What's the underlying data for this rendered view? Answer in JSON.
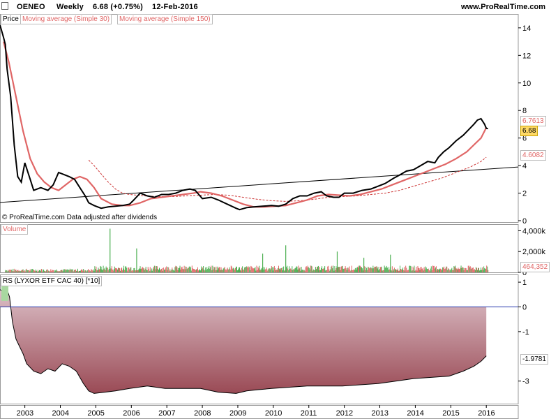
{
  "header": {
    "symbol": "OENEO",
    "period": "Weekly",
    "price_change": "6.68 (+0.75%)",
    "date": "12-Feb-2016",
    "website": "www.ProRealTime.com"
  },
  "price_panel": {
    "legend_price": "Price",
    "legend_ma30": "Moving average (Simple 30)",
    "legend_ma150": "Moving average (Simple 150)",
    "note": "© ProRealTime.com  Data adjusted after dividends",
    "ma30_value": "6.7613",
    "last_price": "6.68",
    "ma150_value": "4.6082"
  },
  "volume_panel": {
    "legend": "Volume",
    "last_value": "464,352"
  },
  "rs_panel": {
    "legend": "RS (LYXOR ETF CAC 40) [*10]",
    "last_value": "-1.9781"
  },
  "colors": {
    "price_line": "#000000",
    "ma30": "#e06666",
    "ma150": "#cc3333",
    "volume_up": "#4caf50",
    "volume_down": "#e06666",
    "rs_zero_line": "#2233aa",
    "rs_fill_top": "#dcc0c8",
    "rs_fill_bottom": "#9a4a55"
  },
  "chart_data": [
    {
      "type": "line",
      "panel": "price",
      "x_ticks": [
        "2003",
        "2004",
        "2005",
        "2006",
        "2007",
        "2008",
        "2009",
        "2010",
        "2011",
        "2012",
        "2013",
        "2014",
        "2015",
        "2016"
      ],
      "y_ticks": [
        0,
        2,
        4,
        6,
        8,
        10,
        12,
        14
      ],
      "ylim": [
        0,
        14.5
      ],
      "series": [
        {
          "name": "Price",
          "x": [
            2002.35,
            2002.45,
            2002.5,
            2002.55,
            2002.65,
            2002.75,
            2002.85,
            2002.95,
            2003.05,
            2003.2,
            2003.3,
            2003.5,
            2003.7,
            2003.85,
            2004.0,
            2004.1,
            2004.3,
            2004.45,
            2004.6,
            2004.75,
            2004.85,
            2005.0,
            2005.2,
            2005.4,
            2005.6,
            2005.8,
            2006.0,
            2006.1,
            2006.3,
            2006.5,
            2006.7,
            2006.9,
            2007.1,
            2007.3,
            2007.5,
            2007.7,
            2007.85,
            2007.95,
            2008.05,
            2008.3,
            2008.5,
            2008.75,
            2009.0,
            2009.1,
            2009.3,
            2009.5,
            2009.75,
            2010.0,
            2010.2,
            2010.4,
            2010.6,
            2010.8,
            2011.0,
            2011.2,
            2011.4,
            2011.55,
            2011.75,
            2011.9,
            2012.05,
            2012.3,
            2012.55,
            2012.8,
            2013.0,
            2013.2,
            2013.45,
            2013.6,
            2013.8,
            2014.0,
            2014.2,
            2014.4,
            2014.6,
            2014.7,
            2014.85,
            2015.0,
            2015.2,
            2015.4,
            2015.55,
            2015.7,
            2015.8,
            2015.9,
            2016.0,
            2016.05,
            2016.1
          ],
          "values": [
            14.2,
            13.3,
            12.8,
            11.0,
            9.0,
            5.5,
            3.2,
            2.8,
            4.2,
            3.0,
            2.2,
            2.4,
            2.2,
            2.6,
            3.5,
            3.4,
            3.2,
            3.0,
            2.4,
            1.8,
            1.3,
            1.1,
            0.9,
            1.0,
            1.05,
            1.1,
            1.2,
            1.45,
            2.0,
            1.8,
            1.7,
            1.9,
            1.9,
            2.0,
            2.2,
            2.3,
            2.2,
            1.9,
            1.6,
            1.7,
            1.5,
            1.2,
            0.9,
            0.8,
            0.95,
            1.0,
            1.05,
            1.1,
            1.05,
            1.2,
            1.6,
            1.8,
            1.8,
            2.0,
            2.1,
            1.8,
            1.7,
            1.7,
            2.0,
            2.0,
            2.2,
            2.3,
            2.5,
            2.7,
            3.1,
            3.3,
            3.6,
            3.7,
            4.0,
            4.3,
            4.2,
            4.6,
            5.0,
            5.3,
            5.8,
            6.2,
            6.6,
            7.0,
            7.3,
            7.4,
            7.0,
            6.7,
            6.68
          ]
        },
        {
          "name": "Moving average (Simple 30)",
          "x": [
            2002.45,
            2002.6,
            2002.8,
            2003.0,
            2003.2,
            2003.4,
            2003.6,
            2003.8,
            2004.0,
            2004.2,
            2004.4,
            2004.6,
            2004.8,
            2005.0,
            2005.2,
            2005.5,
            2005.8,
            2006.0,
            2006.3,
            2006.6,
            2006.9,
            2007.2,
            2007.5,
            2007.8,
            2008.0,
            2008.3,
            2008.6,
            2008.9,
            2009.2,
            2009.5,
            2009.8,
            2010.1,
            2010.4,
            2010.7,
            2011.0,
            2011.3,
            2011.6,
            2011.9,
            2012.2,
            2012.5,
            2012.8,
            2013.1,
            2013.4,
            2013.7,
            2014.0,
            2014.3,
            2014.6,
            2014.9,
            2015.2,
            2015.5,
            2015.7,
            2015.9,
            2016.05
          ],
          "values": [
            13.0,
            11.5,
            9.0,
            6.5,
            4.5,
            3.4,
            2.8,
            2.4,
            2.2,
            2.6,
            3.0,
            3.2,
            3.0,
            2.4,
            1.6,
            1.2,
            1.1,
            1.1,
            1.3,
            1.6,
            1.7,
            1.8,
            1.9,
            2.0,
            2.1,
            2.0,
            1.8,
            1.5,
            1.2,
            1.0,
            1.0,
            1.05,
            1.1,
            1.3,
            1.5,
            1.8,
            1.9,
            1.85,
            1.8,
            1.9,
            2.1,
            2.3,
            2.6,
            2.9,
            3.2,
            3.5,
            3.8,
            4.1,
            4.5,
            5.0,
            5.5,
            6.0,
            6.76
          ]
        },
        {
          "name": "Moving average (Simple 150)",
          "x": [
            2004.85,
            2005.0,
            2005.2,
            2005.4,
            2005.6,
            2005.8,
            2006.0,
            2006.4,
            2006.8,
            2007.2,
            2007.6,
            2008.0,
            2008.4,
            2008.8,
            2009.2,
            2009.6,
            2010.0,
            2010.4,
            2010.8,
            2011.2,
            2011.6,
            2012.0,
            2012.4,
            2012.8,
            2013.2,
            2013.6,
            2014.0,
            2014.4,
            2014.8,
            2015.2,
            2015.6,
            2015.9,
            2016.05
          ],
          "values": [
            4.4,
            4.0,
            3.4,
            2.8,
            2.3,
            2.0,
            1.9,
            1.8,
            1.75,
            1.75,
            1.8,
            1.85,
            1.9,
            1.85,
            1.7,
            1.55,
            1.45,
            1.4,
            1.45,
            1.55,
            1.7,
            1.75,
            1.8,
            1.9,
            2.0,
            2.2,
            2.5,
            2.8,
            3.1,
            3.5,
            3.9,
            4.3,
            4.61
          ]
        }
      ],
      "trendline": {
        "x": [
          2002.2,
          2016.95
        ],
        "values": [
          1.3,
          3.9
        ]
      }
    },
    {
      "type": "bar",
      "panel": "volume",
      "y_ticks": [
        "4,000k",
        "2,000k",
        "0"
      ],
      "ylim": [
        0,
        4500000
      ],
      "last_value": 464352,
      "spikes": [
        {
          "x": 2005.45,
          "value": 4200000
        },
        {
          "x": 2006.2,
          "value": 2300000
        },
        {
          "x": 2009.75,
          "value": 1800000
        },
        {
          "x": 2010.4,
          "value": 2600000
        },
        {
          "x": 2011.85,
          "value": 2000000
        },
        {
          "x": 2013.35,
          "value": 1700000
        },
        {
          "x": 2012.6,
          "value": 1400000
        }
      ]
    },
    {
      "type": "area",
      "panel": "relative_strength",
      "y_ticks": [
        1,
        0,
        -1,
        -3
      ],
      "ylim": [
        -3.8,
        1.2
      ],
      "series": [
        {
          "name": "RS (LYXOR ETF CAC 40) [*10]",
          "x": [
            2002.35,
            2002.45,
            2002.55,
            2002.62,
            2002.7,
            2002.8,
            2002.9,
            2003.0,
            2003.1,
            2003.3,
            2003.5,
            2003.7,
            2003.9,
            2004.1,
            2004.3,
            2004.5,
            2004.7,
            2004.85,
            2005.0,
            2005.3,
            2005.6,
            2006.0,
            2006.5,
            2007.0,
            2007.5,
            2008.0,
            2008.5,
            2009.0,
            2009.3,
            2009.6,
            2010.0,
            2010.5,
            2011.0,
            2011.5,
            2012.0,
            2012.5,
            2013.0,
            2013.5,
            2014.0,
            2014.5,
            2015.0,
            2015.4,
            2015.7,
            2015.9,
            2016.05
          ],
          "values": [
            0.7,
            0.6,
            0.7,
            0.4,
            -0.6,
            -1.3,
            -1.6,
            -1.9,
            -2.3,
            -2.6,
            -2.7,
            -2.5,
            -2.6,
            -2.3,
            -2.4,
            -2.6,
            -3.1,
            -3.4,
            -3.5,
            -3.45,
            -3.4,
            -3.3,
            -3.2,
            -3.3,
            -3.3,
            -3.3,
            -3.45,
            -3.5,
            -3.4,
            -3.35,
            -3.3,
            -3.25,
            -3.2,
            -3.2,
            -3.2,
            -3.15,
            -3.1,
            -3.0,
            -2.9,
            -2.85,
            -2.8,
            -2.6,
            -2.4,
            -2.2,
            -1.98
          ]
        }
      ],
      "zero_line": 0
    }
  ]
}
